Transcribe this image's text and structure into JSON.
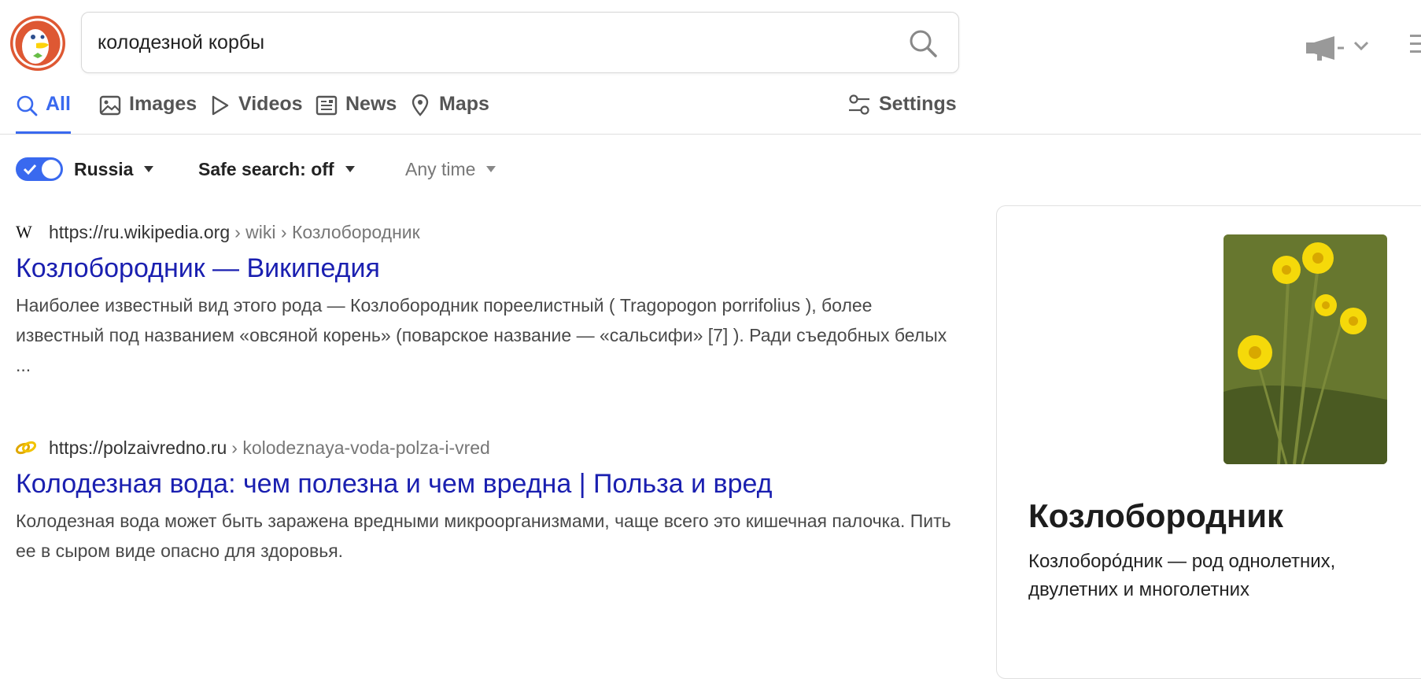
{
  "search": {
    "query": "колодезной корбы"
  },
  "tabs": [
    {
      "label": "All",
      "active": true,
      "icon": "search-icon"
    },
    {
      "label": "Images",
      "active": false,
      "icon": "image-icon"
    },
    {
      "label": "Videos",
      "active": false,
      "icon": "play-icon"
    },
    {
      "label": "News",
      "active": false,
      "icon": "news-icon"
    },
    {
      "label": "Maps",
      "active": false,
      "icon": "map-pin-icon"
    }
  ],
  "settings_label": "Settings",
  "filters": {
    "region_toggle_on": true,
    "region": "Russia",
    "safe_search": "Safe search: off",
    "time": "Any time"
  },
  "results": [
    {
      "favicon": "wikipedia-icon",
      "domain": "https://ru.wikipedia.org",
      "path": "› wiki › Козлобородник",
      "title": "Козлобородник — Википедия",
      "snippet": "Наиболее известный вид этого рода — Козлобородник пореелистный ( Tragopogon porrifolius ), более известный под названием «овсяной корень» (поварское название — «сальсифи» [7] ). Ради съедобных белых ..."
    },
    {
      "favicon": "link-icon",
      "domain": "https://polzaivredno.ru",
      "path": "› kolodeznaya-voda-polza-i-vred",
      "title": "Колодезная вода: чем полезна и чем вредна | Польза и вред",
      "snippet": "Колодезная вода может быть заражена вредными микроорганизмами, чаще всего это кишечная палочка. Пить ее в сыром виде опасно для здоровья."
    }
  ],
  "panel": {
    "title": "Козлобородник",
    "description": "Козлоборо́дник — род однолетних, двулетних и многолетних"
  },
  "colors": {
    "accent": "#3969ef",
    "link": "#1a1fb0",
    "logo": "#de5833"
  }
}
